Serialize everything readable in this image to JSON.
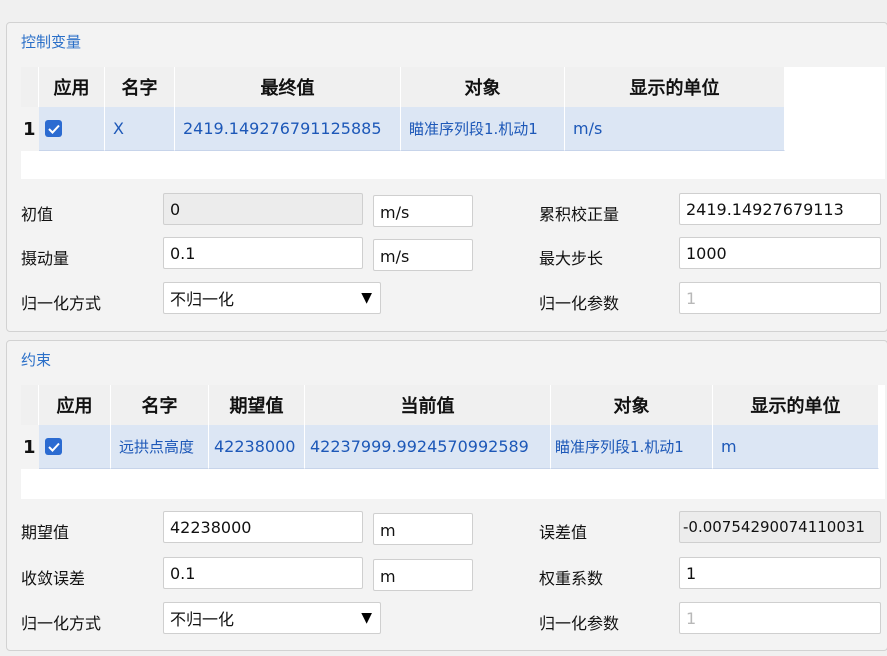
{
  "control": {
    "title": "控制变量",
    "headers": [
      "应用",
      "名字",
      "最终值",
      "对象",
      "显示的单位"
    ],
    "row": {
      "num": "1",
      "name": "X",
      "final": "2419.14927679112588​5",
      "object": "瞄准序列段1.机动1",
      "unit": "m/s"
    },
    "initial_label": "初值",
    "initial_value": "0",
    "initial_unit": "m/s",
    "perturb_label": "摄动量",
    "perturb_value": "0.1",
    "perturb_unit": "m/s",
    "norm_label": "归一化方式",
    "norm_value": "不归一化",
    "cum_label": "累积校正量",
    "cum_value": "2419.14927679113",
    "maxstep_label": "最大步长",
    "maxstep_value": "1000",
    "normparam_label": "归一化参数",
    "normparam_value": "1"
  },
  "constraint": {
    "title": "约束",
    "headers": [
      "应用",
      "名字",
      "期望值",
      "当前值",
      "对象",
      "显示的单位"
    ],
    "row": {
      "num": "1",
      "name": "远拱点高度",
      "desired": "42238000",
      "current": "42237999.9924570992589",
      "object": "瞄准序列段1.机动1",
      "unit": "m"
    },
    "desired_label": "期望值",
    "desired_value": "42238000",
    "desired_unit": "m",
    "tol_label": "收敛误差",
    "tol_value": "0.1",
    "tol_unit": "m",
    "norm_label": "归一化方式",
    "norm_value": "不归一化",
    "err_label": "误差值",
    "err_value": "-0.00754290074110031",
    "weight_label": "权重系数",
    "weight_value": "1",
    "normparam_label": "归一化参数",
    "normparam_value": "1"
  },
  "colors": {
    "accent": "#2a6fc8",
    "row_bg": "#dce6f4",
    "check": "#2b6bd1"
  }
}
